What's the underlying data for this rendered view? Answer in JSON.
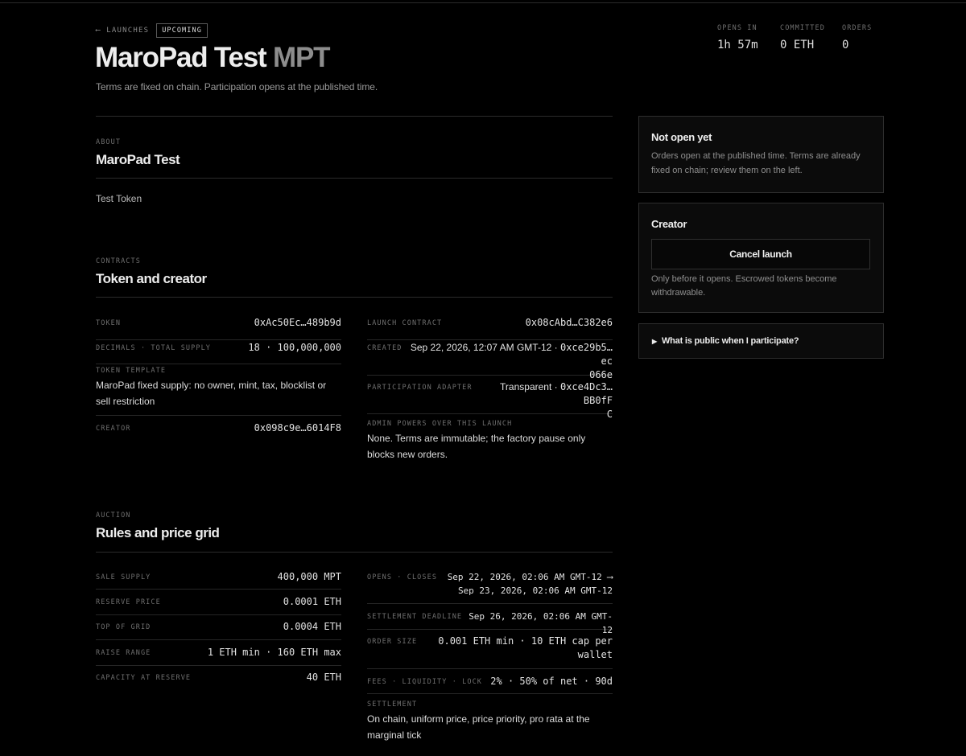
{
  "header": {
    "back_label": "⟵ LAUNCHES",
    "status_badge": "UPCOMING",
    "token_name": "MaroPad Test",
    "token_symbol": "MPT",
    "subtitle": "Terms are fixed on chain. Participation opens at the published time.",
    "stats": [
      {
        "label": "OPENS IN",
        "value": "1h 57m"
      },
      {
        "label": "COMMITTED",
        "value": "0 ETH"
      },
      {
        "label": "ORDERS",
        "value": "0"
      }
    ]
  },
  "about": {
    "eyebrow": "ABOUT",
    "title": "MaroPad Test",
    "description": "Test Token"
  },
  "contracts": {
    "eyebrow": "CONTRACTS",
    "title": "Token and creator",
    "token_label": "TOKEN",
    "token_value": "0xAc50Ec…489b9d",
    "decimals_label": "DECIMALS · TOTAL SUPPLY",
    "decimals_value": "18 · 100,000,000",
    "template_label": "TOKEN TEMPLATE",
    "template_value": "MaroPad fixed supply: no owner, mint, tax, blocklist or sell restriction",
    "creator_label": "CREATOR",
    "creator_value": "0x098c9e…6014F8",
    "launch_label": "LAUNCH CONTRACT",
    "launch_value": "0x08cAbd…C382e6",
    "created_label": "CREATED",
    "created_date": "Sep 22, 2026, 12:07 AM GMT-12 · ",
    "created_tx_1": "0xce29b5…ec",
    "created_tx_2": "066e",
    "adapter_label": "PARTICIPATION ADAPTER",
    "adapter_type": "Transparent · ",
    "adapter_addr_1": "0xce4Dc3…BB0fF",
    "adapter_addr_2": "C",
    "admin_label": "ADMIN POWERS OVER THIS LAUNCH",
    "admin_value": "None. Terms are immutable; the factory pause only blocks new orders."
  },
  "auction": {
    "eyebrow": "AUCTION",
    "title": "Rules and price grid",
    "sale_label": "SALE SUPPLY",
    "sale_value": "400,000 MPT",
    "reserve_label": "RESERVE PRICE",
    "reserve_value": "0.0001 ETH",
    "top_label": "TOP OF GRID",
    "top_value": "0.0004 ETH",
    "raise_label": "RAISE RANGE",
    "raise_value": "1 ETH min · 160 ETH max",
    "capacity_label": "CAPACITY AT RESERVE",
    "capacity_value": "40 ETH",
    "opens_label": "OPENS · CLOSES",
    "opens_value_1": "Sep 22, 2026, 02:06 AM GMT-12 ⟶",
    "opens_value_2": "Sep 23, 2026, 02:06 AM GMT-12",
    "deadline_label": "SETTLEMENT DEADLINE",
    "deadline_value": "Sep 26, 2026, 02:06 AM GMT-12",
    "order_label": "ORDER SIZE",
    "order_value_1": "0.001 ETH min · 10 ETH cap per",
    "order_value_2": "wallet",
    "fees_label": "FEES · LIQUIDITY · LOCK",
    "fees_value": "2% · 50% of net · 90d",
    "settlement_label": "SETTLEMENT",
    "settlement_value": "On chain, uniform price, price priority, pro rata at the marginal tick"
  },
  "sidebar": {
    "status_title": "Not open yet",
    "status_text": "Orders open at the published time. Terms are already fixed on chain; review them on the left.",
    "creator_title": "Creator",
    "cancel_button": "Cancel launch",
    "cancel_note": "Only before it opens. Escrowed tokens become withdrawable.",
    "faq_label": "What is public when I participate?"
  }
}
